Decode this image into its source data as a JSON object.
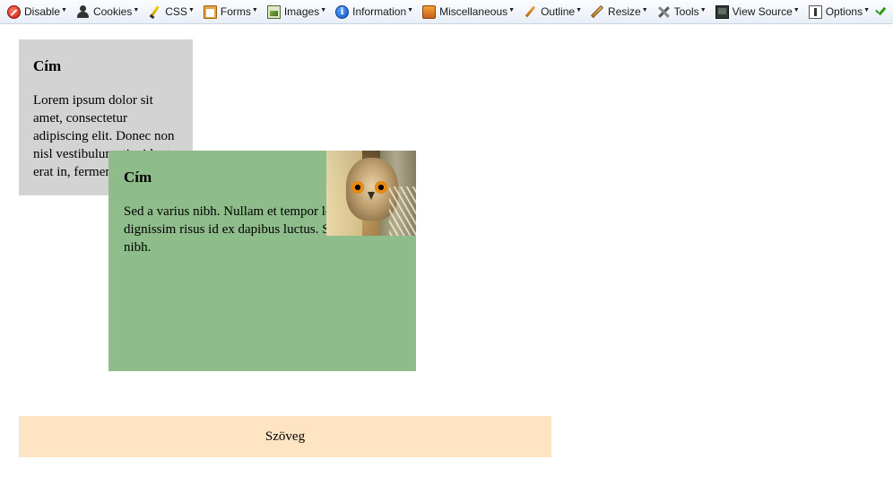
{
  "toolbar": {
    "items": [
      {
        "label": "Disable",
        "icon": "disable-icon"
      },
      {
        "label": "Cookies",
        "icon": "user-icon"
      },
      {
        "label": "CSS",
        "icon": "pencil-icon"
      },
      {
        "label": "Forms",
        "icon": "clipboard-icon"
      },
      {
        "label": "Images",
        "icon": "image-icon"
      },
      {
        "label": "Information",
        "icon": "info-icon"
      },
      {
        "label": "Miscellaneous",
        "icon": "book-icon"
      },
      {
        "label": "Outline",
        "icon": "pencil-icon"
      },
      {
        "label": "Resize",
        "icon": "ruler-icon"
      },
      {
        "label": "Tools",
        "icon": "tools-icon"
      },
      {
        "label": "View Source",
        "icon": "monitor-icon"
      },
      {
        "label": "Options",
        "icon": "options-icon"
      }
    ],
    "status_icons": [
      "check-icon",
      "error-icon"
    ]
  },
  "box1": {
    "title": "Cím",
    "text": "Lorem ipsum dolor sit amet, consectetur adipiscing elit. Donec non nisl vestibulum, tincidunt erat in, fermentum"
  },
  "box2": {
    "title": "Cím",
    "text_line1": "Sed a varius nibh. Nullam et tempor leo. Ut",
    "text_line2": "dignissim risus id ex dapibus luctus. Sed ut",
    "text_line3": "nibh.",
    "image": "owl-photo"
  },
  "footer": {
    "text": "Szöveg"
  },
  "colors": {
    "box1_bg": "#d3d3d3",
    "box2_bg": "#8fbc8b",
    "footer_bg": "#ffe4c4"
  }
}
